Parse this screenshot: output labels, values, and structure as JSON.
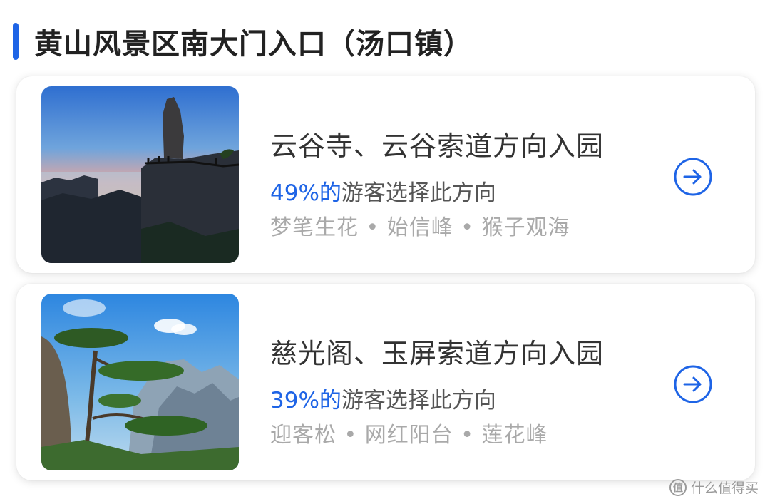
{
  "section": {
    "title": "黄山风景区南大门入口（汤口镇）"
  },
  "routes": [
    {
      "title": "云谷寺、云谷索道方向入园",
      "share_pct": "49%的",
      "share_text": "游客选择此方向",
      "sights": "梦笔生花 • 始信峰 • 猴子观海",
      "action_icon": "arrow-right-circle-icon"
    },
    {
      "title": "慈光阁、玉屏索道方向入园",
      "share_pct": "39%的",
      "share_text": "游客选择此方向",
      "sights": "迎客松 • 网红阳台 • 莲花峰",
      "action_icon": "arrow-right-circle-icon"
    }
  ],
  "watermark": {
    "icon": "值",
    "text": "什么值得买"
  },
  "colors": {
    "accent": "#1e64e6",
    "title": "#222222",
    "muted": "#a9a9a9"
  }
}
